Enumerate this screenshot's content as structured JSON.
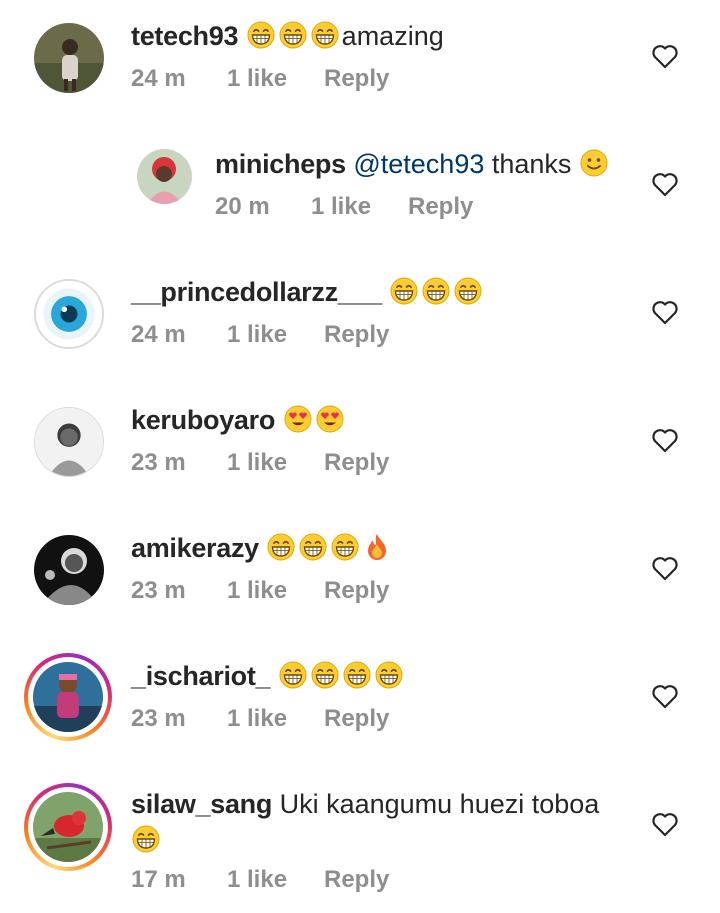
{
  "comments": [
    {
      "username": "tetech93",
      "emojis": [
        "grin-squint",
        "grin-squint",
        "grin-squint"
      ],
      "text": "amazing",
      "time": "24 m",
      "likes": "1 like",
      "reply": "Reply"
    },
    {
      "username": "minicheps",
      "mention": "@tetech93",
      "text": " thanks ",
      "emojis": [
        "slight-smile"
      ],
      "time": "20 m",
      "likes": "1 like",
      "reply": "Reply"
    },
    {
      "username": "__princedollarzz___",
      "emojis": [
        "grin-squint",
        "grin-squint",
        "grin-squint"
      ],
      "time": "24 m",
      "likes": "1 like",
      "reply": "Reply"
    },
    {
      "username": "keruboyaro",
      "emojis": [
        "heart-eyes",
        "heart-eyes"
      ],
      "time": "23 m",
      "likes": "1 like",
      "reply": "Reply"
    },
    {
      "username": "amikerazy",
      "emojis": [
        "grin-squint",
        "grin-squint",
        "grin-squint",
        "fire"
      ],
      "time": "23 m",
      "likes": "1 like",
      "reply": "Reply"
    },
    {
      "username": "_ischariot_",
      "emojis": [
        "grin-squint",
        "grin-squint",
        "grin-squint",
        "grin-squint"
      ],
      "time": "23 m",
      "likes": "1 like",
      "reply": "Reply"
    },
    {
      "username": "silaw_sang",
      "text": "Uki kaangumu huezi toboa",
      "emojis": [
        "grin-squint"
      ],
      "time": "17 m",
      "likes": "1 like",
      "reply": "Reply"
    }
  ],
  "icons": {
    "like": "heart-outline-icon"
  },
  "colors": {
    "text": "#262626",
    "meta": "#8e8e8e",
    "mention": "#00376b",
    "emoji_yellow": "#ffcc33"
  }
}
